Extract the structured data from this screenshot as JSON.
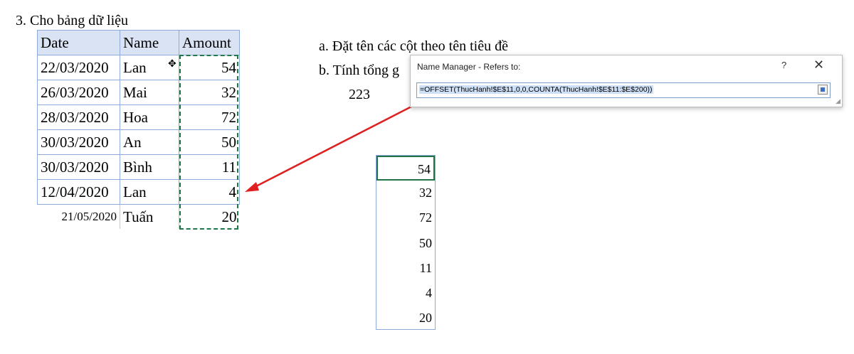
{
  "heading": "3. Cho bảng dữ liệu",
  "table": {
    "headers": [
      "Date",
      "Name",
      "Amount"
    ],
    "rows": [
      [
        "22/03/2020",
        "Lan",
        "54"
      ],
      [
        "26/03/2020",
        "Mai",
        "32"
      ],
      [
        "28/03/2020",
        "Hoa",
        "72"
      ],
      [
        "30/03/2020",
        "An",
        "50"
      ],
      [
        "30/03/2020",
        "Bình",
        "11"
      ],
      [
        "12/04/2020",
        "Lan",
        "4"
      ]
    ],
    "extra_row": [
      "21/05/2020",
      "Tuấn",
      "20"
    ]
  },
  "questions": {
    "a": "a. Đặt tên các cột theo tên tiêu đề",
    "b": "b. Tính tổng g",
    "result": "223"
  },
  "dialog": {
    "title": "Name Manager - Refers to:",
    "help": "?",
    "close": "✕",
    "formula": "=OFFSET(ThucHanh!$E$11,0,0,COUNTA(ThucHanh!$E$11:$E$200))"
  },
  "spill_values": [
    "54",
    "32",
    "72",
    "50",
    "11",
    "4",
    "20"
  ],
  "colors": {
    "header_fill": "#dae3f3",
    "cell_border": "#8eaadb",
    "marquee": "#1f7a4a",
    "arrow": "#e02020"
  }
}
